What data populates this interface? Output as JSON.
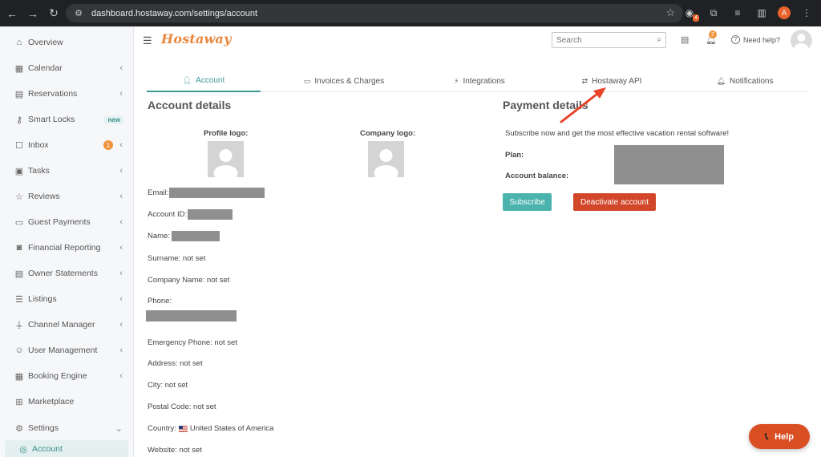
{
  "browser": {
    "url": "dashboard.hostaway.com/settings/account",
    "ext_badge": "4",
    "profile_initial": "A"
  },
  "sidebar": {
    "items": [
      {
        "label": "Overview",
        "icon": "home-icon"
      },
      {
        "label": "Calendar",
        "icon": "calendar-icon"
      },
      {
        "label": "Reservations",
        "icon": "calendar-check-icon"
      },
      {
        "label": "Smart Locks",
        "icon": "key-icon",
        "badge": "new"
      },
      {
        "label": "Inbox",
        "icon": "chat-icon",
        "count": "1"
      },
      {
        "label": "Tasks",
        "icon": "briefcase-icon"
      },
      {
        "label": "Reviews",
        "icon": "star-icon"
      },
      {
        "label": "Guest Payments",
        "icon": "card-icon"
      },
      {
        "label": "Financial Reporting",
        "icon": "money-icon"
      },
      {
        "label": "Owner Statements",
        "icon": "statement-icon"
      },
      {
        "label": "Listings",
        "icon": "list-icon"
      },
      {
        "label": "Channel Manager",
        "icon": "plug-icon"
      },
      {
        "label": "User Management",
        "icon": "user-icon"
      },
      {
        "label": "Booking Engine",
        "icon": "booking-icon"
      },
      {
        "label": "Marketplace",
        "icon": "marketplace-icon"
      },
      {
        "label": "Settings",
        "icon": "gear-icon"
      }
    ],
    "sub_item": {
      "label": "Account",
      "icon": "user-circle-icon"
    }
  },
  "header": {
    "logo": "Hostaway",
    "search_placeholder": "Search",
    "notifications_count": "2",
    "need_help": "Need help?"
  },
  "tabs": [
    {
      "label": "Account",
      "icon": "user-icon",
      "active": true
    },
    {
      "label": "Invoices & Charges",
      "icon": "credit-card-icon"
    },
    {
      "label": "Integrations",
      "icon": "plug-icon"
    },
    {
      "label": "Hostaway API",
      "icon": "exchange-icon"
    },
    {
      "label": "Notifications",
      "icon": "bell-icon"
    }
  ],
  "account": {
    "title": "Account details",
    "profile_logo_label": "Profile logo:",
    "company_logo_label": "Company logo:",
    "email_label": "Email:",
    "account_id_label": "Account ID:",
    "name_label": "Name:",
    "surname": "Surname: not set",
    "company_name": "Company Name: not set",
    "phone_label": "Phone:",
    "emergency_phone": "Emergency Phone: not set",
    "address": "Address: not set",
    "city": "City: not set",
    "postal_code": "Postal Code: not set",
    "country_label": "Country:",
    "country_value": "United States of America",
    "website": "Website: not set"
  },
  "payment": {
    "title": "Payment details",
    "subscribe_text": "Subscribe now and get the most effective vacation rental software!",
    "plan_label": "Plan:",
    "balance_label": "Account balance:",
    "subscribe_button": "Subscribe",
    "deactivate_button": "Deactivate account"
  },
  "help_button": "Help",
  "colors": {
    "accent": "#3a9a94",
    "brand": "#e8873d",
    "danger": "#d2462a",
    "annotation_arrow": "#e8442a"
  }
}
